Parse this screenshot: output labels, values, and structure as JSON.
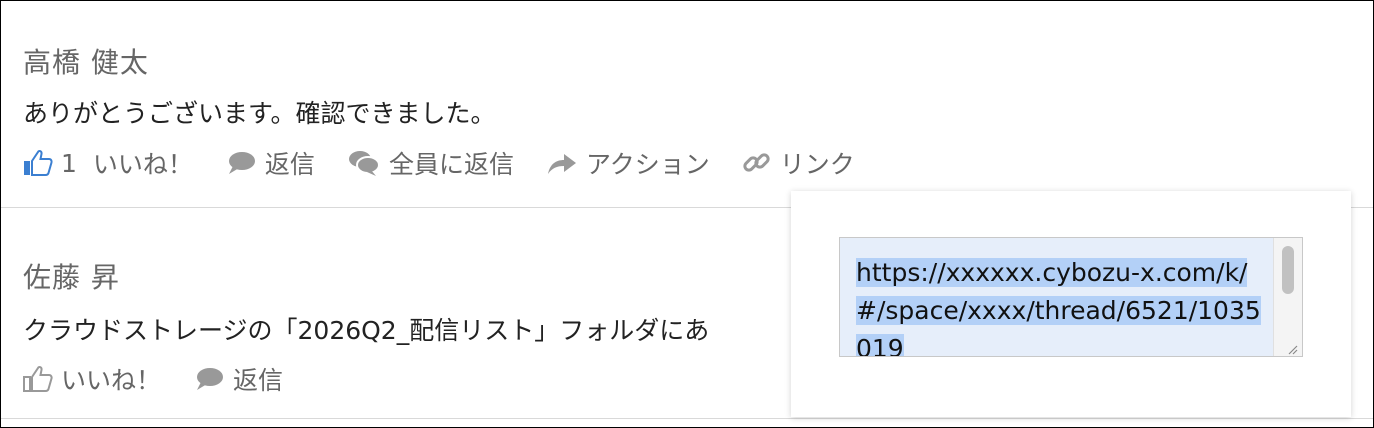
{
  "posts": [
    {
      "author": "高橋 健太",
      "body": "ありがとうございます。確認できました。",
      "like_count": "1",
      "actions": {
        "like": "いいね！",
        "reply": "返信",
        "reply_all": "全員に返信",
        "action": "アクション",
        "link": "リンク"
      }
    },
    {
      "author": "佐藤 昇",
      "body": "クラウドストレージの「2026Q2_配信リスト」フォルダにあ",
      "actions": {
        "like": "いいね！",
        "reply": "返信"
      }
    }
  ],
  "link_popup": {
    "url": "https://xxxxxx.cybozu-x.com/k/#/space/xxxx/thread/6521/1035019"
  },
  "colors": {
    "like_active": "#3b7fd1",
    "icon_gray": "#999999",
    "selection": "#b3d0f7"
  },
  "icons": {
    "like": "thumbs-up-icon",
    "reply": "speech-bubble-icon",
    "reply_all": "double-speech-bubble-icon",
    "action": "arrow-right-icon",
    "link": "chain-link-icon"
  }
}
